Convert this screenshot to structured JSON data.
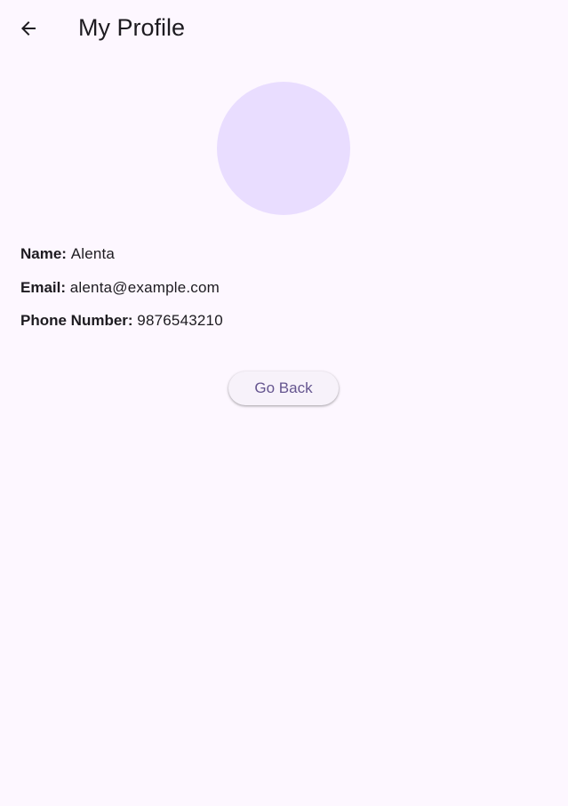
{
  "app_bar": {
    "title": "My Profile",
    "back_icon": "arrow-back-icon"
  },
  "profile": {
    "avatar_color": "#e9ddff",
    "fields": [
      {
        "label": "Name:",
        "value": "Alenta"
      },
      {
        "label": "Email:",
        "value": "alenta@example.com"
      },
      {
        "label": "Phone Number:",
        "value": "9876543210"
      }
    ]
  },
  "actions": {
    "go_back_label": "Go Back"
  },
  "colors": {
    "background": "#fdf7ff",
    "primary": "#65558f",
    "text": "#1d1b20",
    "button_surface": "#f7f2fa"
  }
}
